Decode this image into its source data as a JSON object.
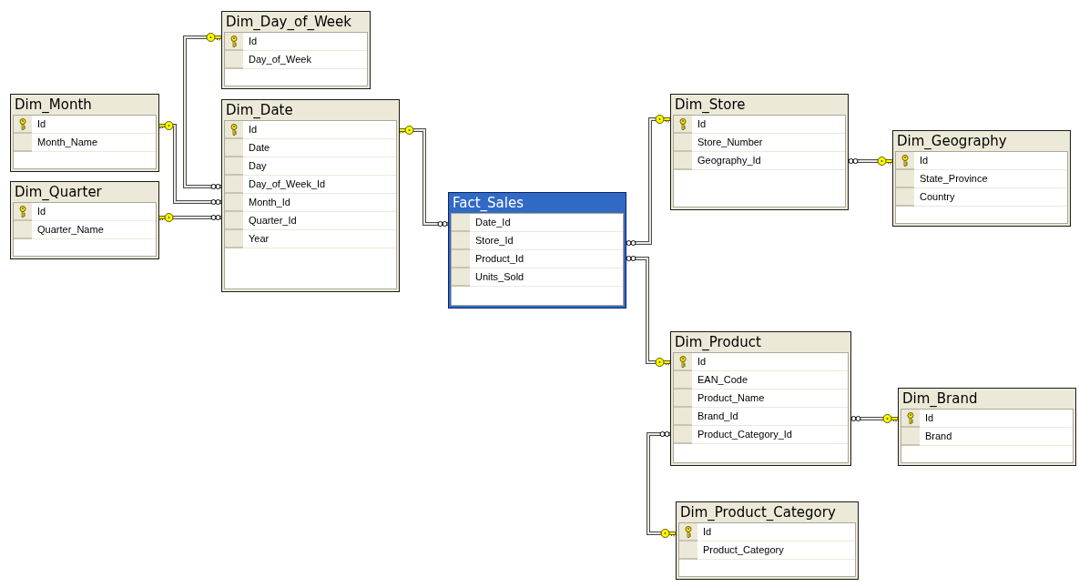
{
  "tables": [
    {
      "name": "Dim_Day_of_Week",
      "selected": false,
      "columns": [
        {
          "name": "Id",
          "primary_key": true
        },
        {
          "name": "Day_of_Week",
          "primary_key": false
        }
      ]
    },
    {
      "name": "Dim_Month",
      "selected": false,
      "columns": [
        {
          "name": "Id",
          "primary_key": true
        },
        {
          "name": "Month_Name",
          "primary_key": false
        }
      ]
    },
    {
      "name": "Dim_Date",
      "selected": false,
      "columns": [
        {
          "name": "Id",
          "primary_key": true
        },
        {
          "name": "Date",
          "primary_key": false
        },
        {
          "name": "Day",
          "primary_key": false
        },
        {
          "name": "Day_of_Week_Id",
          "primary_key": false
        },
        {
          "name": "Month_Id",
          "primary_key": false
        },
        {
          "name": "Quarter_Id",
          "primary_key": false
        },
        {
          "name": "Year",
          "primary_key": false
        }
      ]
    },
    {
      "name": "Dim_Quarter",
      "selected": false,
      "columns": [
        {
          "name": "Id",
          "primary_key": true
        },
        {
          "name": "Quarter_Name",
          "primary_key": false
        }
      ]
    },
    {
      "name": "Fact_Sales",
      "selected": true,
      "columns": [
        {
          "name": "Date_Id",
          "primary_key": false
        },
        {
          "name": "Store_Id",
          "primary_key": false
        },
        {
          "name": "Product_Id",
          "primary_key": false
        },
        {
          "name": "Units_Sold",
          "primary_key": false
        }
      ]
    },
    {
      "name": "Dim_Store",
      "selected": false,
      "columns": [
        {
          "name": "Id",
          "primary_key": true
        },
        {
          "name": "Store_Number",
          "primary_key": false
        },
        {
          "name": "Geography_Id",
          "primary_key": false
        }
      ]
    },
    {
      "name": "Dim_Geography",
      "selected": false,
      "columns": [
        {
          "name": "Id",
          "primary_key": true
        },
        {
          "name": "State_Province",
          "primary_key": false
        },
        {
          "name": "Country",
          "primary_key": false
        }
      ]
    },
    {
      "name": "Dim_Product",
      "selected": false,
      "columns": [
        {
          "name": "Id",
          "primary_key": true
        },
        {
          "name": "EAN_Code",
          "primary_key": false
        },
        {
          "name": "Product_Name",
          "primary_key": false
        },
        {
          "name": "Brand_Id",
          "primary_key": false
        },
        {
          "name": "Product_Category_Id",
          "primary_key": false
        }
      ]
    },
    {
      "name": "Dim_Brand",
      "selected": false,
      "columns": [
        {
          "name": "Id",
          "primary_key": true
        },
        {
          "name": "Brand",
          "primary_key": false
        }
      ]
    },
    {
      "name": "Dim_Product_Category",
      "selected": false,
      "columns": [
        {
          "name": "Id",
          "primary_key": true
        },
        {
          "name": "Product_Category",
          "primary_key": false
        }
      ]
    }
  ]
}
